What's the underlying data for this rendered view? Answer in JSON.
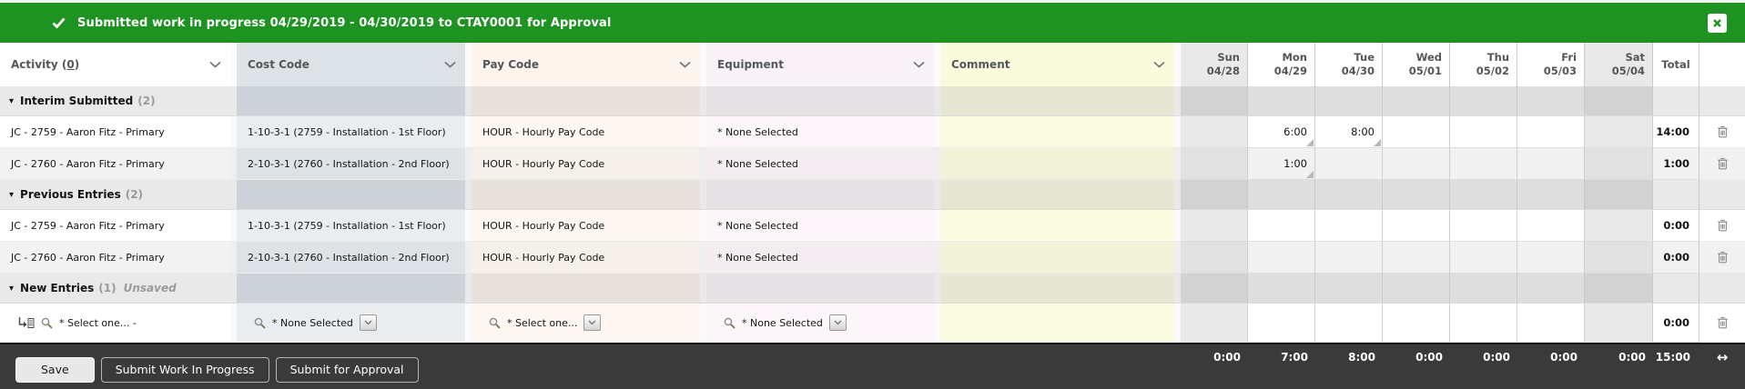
{
  "banner": {
    "message": "Submitted work in progress 04/29/2019 - 04/30/2019 to CTAY0001 for Approval"
  },
  "icons": {
    "check": "check-icon",
    "close": "close-icon",
    "chevron_down": "chevron-down-icon",
    "caret": "▾",
    "resize": "↔"
  },
  "table": {
    "columns": [
      {
        "key": "act",
        "label": "Activity",
        "count": "0"
      },
      {
        "key": "cost",
        "label": "Cost Code"
      },
      {
        "key": "pay",
        "label": "Pay Code"
      },
      {
        "key": "equip",
        "label": "Equipment"
      },
      {
        "key": "comment",
        "label": "Comment"
      }
    ],
    "days": [
      {
        "name": "Sun",
        "date": "04/28",
        "weekend": true
      },
      {
        "name": "Mon",
        "date": "04/29",
        "weekend": false
      },
      {
        "name": "Tue",
        "date": "04/30",
        "weekend": false
      },
      {
        "name": "Wed",
        "date": "05/01",
        "weekend": false
      },
      {
        "name": "Thu",
        "date": "05/02",
        "weekend": false
      },
      {
        "name": "Fri",
        "date": "05/03",
        "weekend": false
      },
      {
        "name": "Sat",
        "date": "05/04",
        "weekend": true
      }
    ],
    "total_label": "Total",
    "groups": [
      {
        "label": "Interim Submitted",
        "count": "(2)",
        "note": "",
        "rows": [
          {
            "activity": "JC - 2759 - Aaron Fitz - Primary",
            "cost_code": "1-10-3-1 (2759 - Installation - 1st Floor)",
            "pay_code": "HOUR - Hourly Pay Code",
            "equipment": "* None Selected",
            "comment": "",
            "hours": [
              "",
              "6:00",
              "8:00",
              "",
              "",
              "",
              ""
            ],
            "noted_days": [
              1,
              2
            ],
            "total": "14:00"
          },
          {
            "activity": "JC - 2760 - Aaron Fitz - Primary",
            "cost_code": "2-10-3-1 (2760 - Installation - 2nd Floor)",
            "pay_code": "HOUR - Hourly Pay Code",
            "equipment": "* None Selected",
            "comment": "",
            "hours": [
              "",
              "1:00",
              "",
              "",
              "",
              "",
              ""
            ],
            "noted_days": [
              1
            ],
            "total": "1:00"
          }
        ]
      },
      {
        "label": "Previous Entries",
        "count": "(2)",
        "note": "",
        "rows": [
          {
            "activity": "JC - 2759 - Aaron Fitz - Primary",
            "cost_code": "1-10-3-1 (2759 - Installation - 1st Floor)",
            "pay_code": "HOUR - Hourly Pay Code",
            "equipment": "* None Selected",
            "comment": "",
            "hours": [
              "",
              "",
              "",
              "",
              "",
              "",
              ""
            ],
            "noted_days": [],
            "total": "0:00"
          },
          {
            "activity": "JC - 2760 - Aaron Fitz - Primary",
            "cost_code": "2-10-3-1 (2760 - Installation - 2nd Floor)",
            "pay_code": "HOUR - Hourly Pay Code",
            "equipment": "* None Selected",
            "comment": "",
            "hours": [
              "",
              "",
              "",
              "",
              "",
              "",
              ""
            ],
            "noted_days": [],
            "total": "0:00"
          }
        ]
      },
      {
        "label": "New Entries",
        "count": "(1)",
        "note": "Unsaved",
        "rows": [
          {
            "type": "new",
            "activity_select": "* Select one... -",
            "cost_select": "* None Selected",
            "pay_select": "* Select one...",
            "equipment_select": "* None Selected",
            "comment": "",
            "hours": [
              "",
              "",
              "",
              "",
              "",
              "",
              ""
            ],
            "noted_days": [],
            "total": "0:00"
          }
        ]
      }
    ]
  },
  "footer": {
    "buttons": [
      {
        "label": "Save",
        "style": "light"
      },
      {
        "label": "Submit Work In Progress",
        "style": "dark"
      },
      {
        "label": "Submit for Approval",
        "style": "dark"
      }
    ],
    "day_totals": [
      "0:00",
      "7:00",
      "8:00",
      "0:00",
      "0:00",
      "0:00",
      "0:00"
    ],
    "grand_total": "15:00"
  }
}
